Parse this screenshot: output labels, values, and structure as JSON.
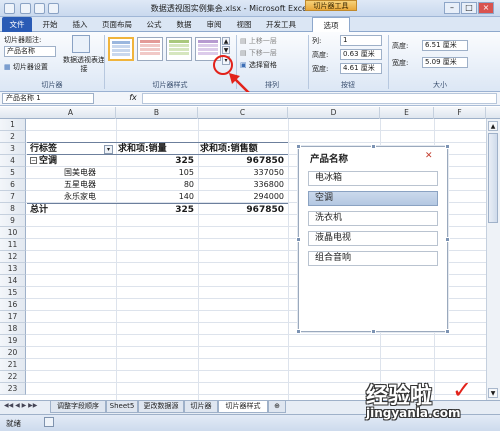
{
  "window": {
    "title": "数据透视图实例集会.xlsx - Microsoft Excel",
    "contextual_tab": "切片器工具"
  },
  "ribbon_tabs": [
    "文件",
    "开始",
    "插入",
    "页面布局",
    "公式",
    "数据",
    "审阅",
    "视图",
    "开发工具",
    "选项"
  ],
  "ribbon": {
    "slicer_group": {
      "caption_label": "切片器题注:",
      "caption_value": "产品名称",
      "settings_label": "切片器设置",
      "connections_label": "数据透视表连接",
      "group_name": "切片器"
    },
    "styles_group": {
      "group_name": "切片器样式"
    },
    "arrange_group": {
      "bring_forward": "上移一层",
      "send_backward": "下移一层",
      "selection_pane": "选择窗格",
      "group_name": "排列"
    },
    "buttons_group": {
      "columns_label": "列:",
      "columns_value": "1",
      "height_label": "高度:",
      "height_value": "0.63 厘米",
      "width_label": "宽度:",
      "width_value": "4.61 厘米",
      "group_name": "按钮"
    },
    "size_group": {
      "height_label": "高度:",
      "height_value": "6.51 厘米",
      "width_label": "宽度:",
      "width_value": "5.09 厘米",
      "group_name": "大小"
    }
  },
  "formula_bar": {
    "name_box": "产品名称 1",
    "fx": "fx",
    "formula": ""
  },
  "columns": [
    "A",
    "B",
    "C",
    "D",
    "E",
    "F"
  ],
  "rows": [
    "1",
    "2",
    "3",
    "4",
    "5",
    "6",
    "7",
    "8",
    "9",
    "10",
    "11",
    "12",
    "13",
    "14",
    "15",
    "16",
    "17",
    "18",
    "19",
    "20",
    "21",
    "22",
    "23"
  ],
  "pivot": {
    "header": {
      "label": "行标签",
      "col1": "求和项:销量",
      "col2": "求和项:销售额"
    },
    "group": {
      "label": "空调",
      "qty": "325",
      "sales": "967850"
    },
    "rows": [
      {
        "label": "国美电器",
        "qty": "105",
        "sales": "337050"
      },
      {
        "label": "五星电器",
        "qty": "80",
        "sales": "336800"
      },
      {
        "label": "永乐家电",
        "qty": "140",
        "sales": "294000"
      }
    ],
    "total": {
      "label": "总计",
      "qty": "325",
      "sales": "967850"
    }
  },
  "slicer": {
    "title": "产品名称",
    "items": [
      {
        "label": "电冰箱",
        "selected": false
      },
      {
        "label": "空调",
        "selected": true
      },
      {
        "label": "洗衣机",
        "selected": false
      },
      {
        "label": "液晶电视",
        "selected": false
      },
      {
        "label": "组合音响",
        "selected": false
      }
    ]
  },
  "sheet_tabs": [
    "调整字段顺序",
    "Sheet5",
    "更改数据源",
    "切片器",
    "切片器样式"
  ],
  "active_sheet": "切片器样式",
  "status": {
    "ready": "就绪"
  },
  "watermark": {
    "text": "经验啦",
    "url": "jingyanla.com"
  },
  "colors": {
    "file_tab": "#2a5bb5",
    "annotation": "#e2221a",
    "selected_item": "#b4c8e2"
  }
}
